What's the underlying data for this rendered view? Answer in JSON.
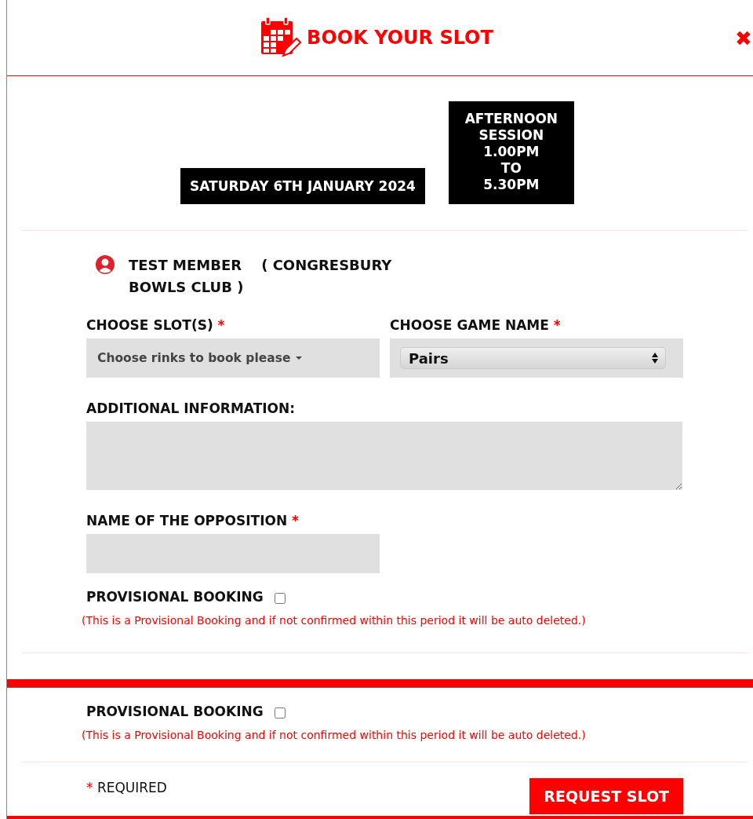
{
  "header": {
    "title": "BOOK YOUR SLOT",
    "close": "✖"
  },
  "date": "SATURDAY 6TH JANUARY 2024",
  "session": [
    "AFTERNOON",
    "SESSION",
    "1.00PM",
    "TO",
    "5.30PM"
  ],
  "member": {
    "name": "TEST MEMBER",
    "club": "( CONGRESBURY BOWLS CLUB )"
  },
  "fields": [
    {
      "kind": "dropdown",
      "label": "CHOOSE SLOT(S)",
      "required_mark": "*",
      "value": "Choose rinks to book please"
    },
    {
      "kind": "select",
      "label": "CHOOSE GAME NAME",
      "required_mark": "*",
      "value": "Pairs"
    },
    {
      "kind": "textarea",
      "label": "ADDITIONAL INFORMATION:"
    },
    {
      "kind": "text",
      "label": "NAME OF THE OPPOSITION",
      "required_mark": "*"
    }
  ],
  "provisional_sections": [
    {
      "label": "PROVISIONAL BOOKING",
      "checked": false,
      "note": "(This is a Provisional Booking and if not confirmed within this period it will be auto deleted.)"
    },
    {
      "label": "PROVISIONAL BOOKING",
      "checked": false,
      "note": "(This is a Provisional Booking and if not confirmed within this period it will be auto deleted.)"
    }
  ],
  "footer": {
    "required_mark": "*",
    "required_text": "REQUIRED",
    "submit": "REQUEST SLOT"
  }
}
